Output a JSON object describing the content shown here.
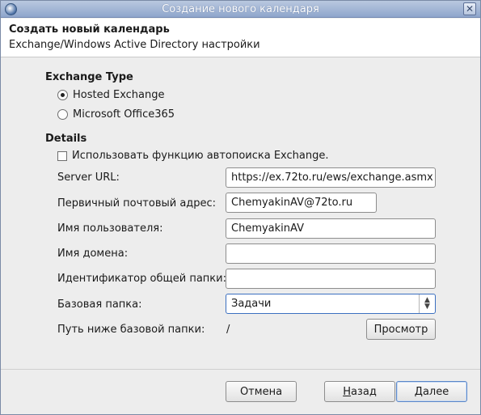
{
  "window": {
    "title": "Создание нового календаря",
    "close_glyph": "✕"
  },
  "header": {
    "title": "Создать новый календарь",
    "subtitle": "Exchange/Windows Active Directory настройки"
  },
  "exchange_type": {
    "label": "Exchange Type",
    "options": [
      {
        "label": "Hosted Exchange",
        "checked": true
      },
      {
        "label": "Microsoft Office365",
        "checked": false
      }
    ]
  },
  "details": {
    "label": "Details",
    "autodiscover": {
      "label": "Использовать функцию автопоиска Exchange.",
      "checked": false
    },
    "server_url": {
      "label": "Server URL:",
      "value": "https://ex.72to.ru/ews/exchange.asmx"
    },
    "primary_email": {
      "label": "Первичный почтовый адрес:",
      "value": "ChemyakinAV@72to.ru"
    },
    "username": {
      "label": "Имя пользователя:",
      "value": "ChemyakinAV"
    },
    "domain": {
      "label": "Имя домена:",
      "value": ""
    },
    "shared_folder": {
      "label": "Идентификатор общей папки:",
      "value": ""
    },
    "base_folder": {
      "label": "Базовая папка:",
      "value": "Задачи"
    },
    "path_below": {
      "label": "Путь ниже базовой папки:",
      "value": "/",
      "browse_label": "Просмотр"
    }
  },
  "footer": {
    "cancel": "Отмена",
    "back_first": "Н",
    "back_rest": "азад",
    "next_first": "Д",
    "next_rest": "алее"
  },
  "icons": {
    "window_icon": "app-icon",
    "close": "close-icon"
  }
}
